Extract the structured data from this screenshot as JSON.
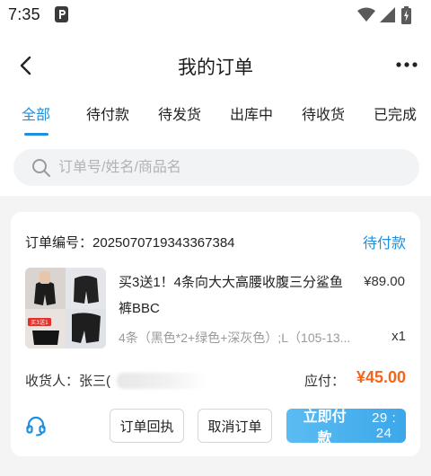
{
  "status_bar": {
    "time": "7:35"
  },
  "nav": {
    "title": "我的订单"
  },
  "tabs": [
    {
      "label": "全部",
      "active": true
    },
    {
      "label": "待付款",
      "active": false
    },
    {
      "label": "待发货",
      "active": false
    },
    {
      "label": "出库中",
      "active": false
    },
    {
      "label": "待收货",
      "active": false
    },
    {
      "label": "已完成",
      "active": false
    }
  ],
  "search": {
    "placeholder": "订单号/姓名/商品名",
    "value": ""
  },
  "order": {
    "number_label": "订单编号：",
    "number": "2025070719343367384",
    "status": "待付款",
    "product_title": "买3送1！4条向大大高腰收腹三分鲨鱼裤BBC",
    "price": "¥89.00",
    "spec": "4条（黑色*2+绿色+深灰色）;L（105-13...",
    "quantity": "x1",
    "consignee_label": "收货人：张三(",
    "payable_label": "应付：",
    "payable_amount": "¥45.00",
    "thumb_badge": "买3送1",
    "buttons": {
      "receipt": "订单回执",
      "cancel": "取消订单",
      "pay": "立即付款",
      "countdown": "29 : 24"
    }
  },
  "colors": {
    "accent": "#1e8fe0",
    "price_orange": "#f5651b",
    "pay_button": "#4aaeee"
  },
  "icons": [
    "back-arrow-icon",
    "more-dots-icon",
    "search-icon",
    "headset-icon",
    "wifi-icon",
    "signal-icon",
    "battery-icon",
    "app-notification-icon"
  ]
}
